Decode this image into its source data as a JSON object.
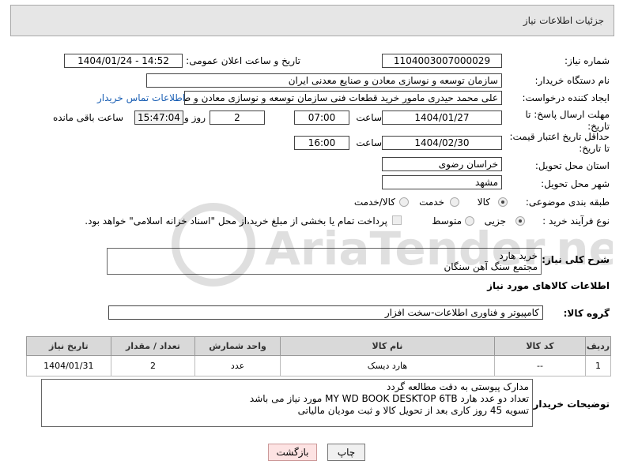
{
  "panel": {
    "title": "جزئیات اطلاعات نیاز"
  },
  "fields": {
    "need_number_label": "شماره نیاز:",
    "need_number": "1104003007000029",
    "announce_label": "تاریخ و ساعت اعلان عمومی:",
    "announce_value": "1404/01/24 - 14:52",
    "buyer_org_label": "نام دستگاه خریدار:",
    "buyer_org": "سازمان توسعه و نوسازی معادن و صنایع معدنی ایران",
    "creator_label": "ایجاد کننده درخواست:",
    "creator": "علی محمد حیدری مامور خرید قطعات فنی سازمان توسعه و نوسازی معادن و ص",
    "contact_link": "اطلاعات تماس خریدار",
    "deadline_label": "مهلت ارسال پاسخ: تا تاریخ:",
    "deadline_date": "1404/01/27",
    "time_label": "ساعت",
    "deadline_time": "07:00",
    "days_value": "2",
    "days_label": "روز و",
    "remaining_time": "15:47:04",
    "remaining_label": "ساعت باقی مانده",
    "validity_label": "حداقل تاریخ اعتبار قیمت: تا تاریخ:",
    "validity_date": "1404/02/30",
    "validity_time": "16:00",
    "province_label": "استان محل تحویل:",
    "province": "خراسان رضوی",
    "city_label": "شهر محل تحویل:",
    "city": "مشهد",
    "category_label": "طبقه بندی موضوعی:",
    "category_options": [
      "کالا",
      "خدمت",
      "کالا/خدمت"
    ],
    "process_label": "نوع فرآیند خرید :",
    "process_options": [
      "جزیی",
      "متوسط"
    ],
    "payment_note": "پرداخت تمام یا بخشی از مبلغ خرید،از محل \"اسناد خزانه اسلامی\" خواهد بود.",
    "desc_label": "شرح کلی نیاز:",
    "desc_value": "خرید هارد\nمجتمع سنگ آهن سنگان",
    "goods_info_title": "اطلاعات کالاهای مورد نیاز",
    "goods_group_label": "گروه کالا:",
    "goods_group": "کامپیوتر و فناوری اطلاعات-سخت افزار",
    "buyer_notes_label": "توضیحات خریدار:",
    "buyer_notes": "مدارک پیوستی به دقت مطالعه گردد\nتعداد دو عدد هارد MY WD BOOK DESKTOP 6TB  مورد نیاز می باشد\nتسویه 45 روز کاری بعد از تحویل کالا و ثبت مودیان مالیاتی"
  },
  "table": {
    "headers": [
      "ردیف",
      "کد کالا",
      "نام کالا",
      "واحد شمارش",
      "تعداد / مقدار",
      "تاریخ نیاز"
    ],
    "rows": [
      [
        "1",
        "--",
        "هارد دیسک",
        "عدد",
        "2",
        "1404/01/31"
      ]
    ]
  },
  "buttons": {
    "print": "چاپ",
    "back": "بازگشت"
  },
  "watermark": "AriaTender.neT"
}
